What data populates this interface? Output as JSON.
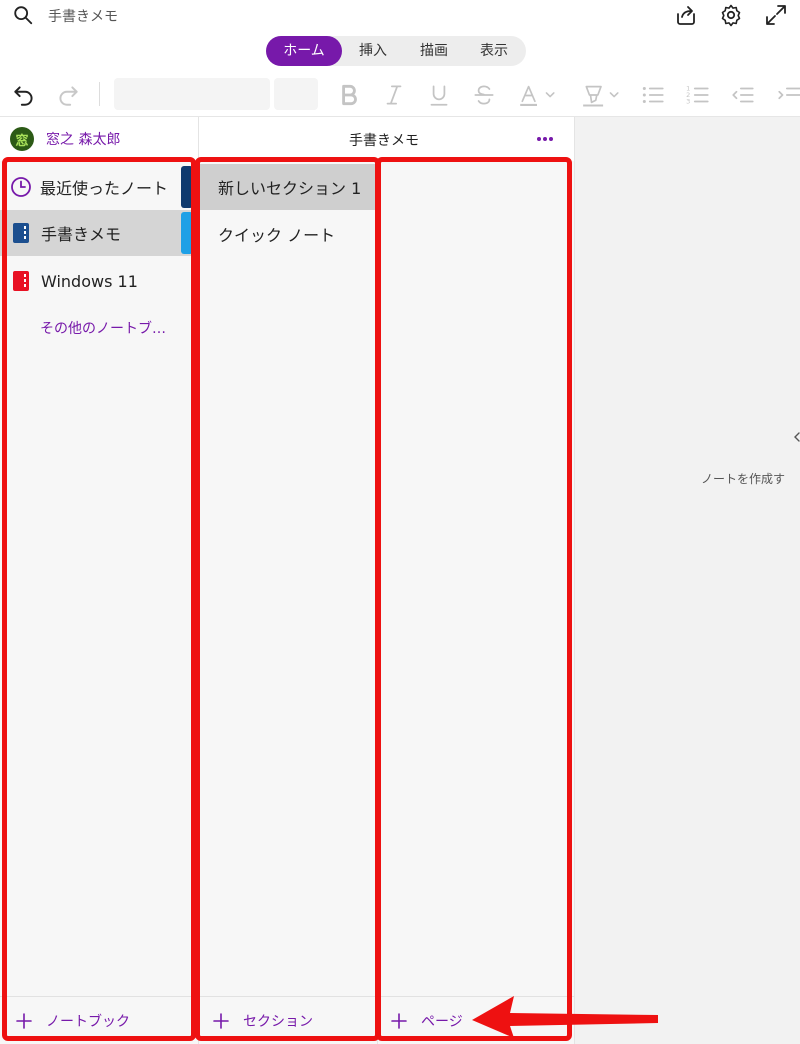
{
  "app": {
    "title": "手書きメモ"
  },
  "tabs": [
    "ホーム",
    "挿入",
    "描画",
    "表示"
  ],
  "user": {
    "name": "窓之 森太郎",
    "avatar_glyph": "窓"
  },
  "notebook_header": {
    "title": "手書きメモ"
  },
  "notebooks": {
    "items": [
      {
        "label": "最近使ったノート",
        "color": "#7719aa"
      },
      {
        "label": "手書きメモ",
        "color": "#1c4f8f"
      },
      {
        "label": "Windows 11",
        "color": "#e81123"
      }
    ],
    "more_label": "その他のノートブ…",
    "add_label": "ノートブック"
  },
  "sections": {
    "items": [
      {
        "label": "新しいセクション 1"
      },
      {
        "label": "クイック ノート"
      }
    ],
    "add_label": "セクション"
  },
  "pages": {
    "add_label": "ページ"
  },
  "canvas": {
    "message": "ノートを作成す"
  },
  "colors": {
    "accent": "#7719aa",
    "highlight": "#ee1111",
    "strip_recent": "#0f3a6e",
    "strip_handwritten": "#1ea0e6"
  }
}
